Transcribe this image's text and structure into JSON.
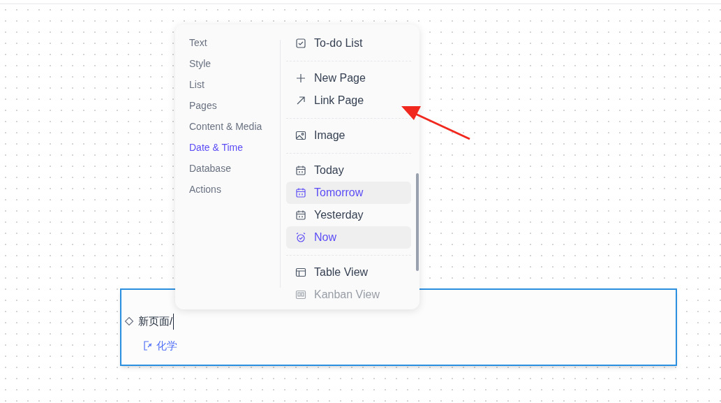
{
  "menu": {
    "categories": [
      {
        "label": "Text",
        "selected": false
      },
      {
        "label": "Style",
        "selected": false
      },
      {
        "label": "List",
        "selected": false
      },
      {
        "label": "Pages",
        "selected": false
      },
      {
        "label": "Content & Media",
        "selected": false
      },
      {
        "label": "Date & Time",
        "selected": true
      },
      {
        "label": "Database",
        "selected": false
      },
      {
        "label": "Actions",
        "selected": false
      }
    ],
    "groups": [
      [
        {
          "kind": "todo",
          "label": "To-do List",
          "selected": false,
          "disabled": false
        }
      ],
      [
        {
          "kind": "plus",
          "label": "New Page",
          "selected": false,
          "disabled": false
        },
        {
          "kind": "arrow",
          "label": "Link Page",
          "selected": false,
          "disabled": false
        }
      ],
      [
        {
          "kind": "image",
          "label": "Image",
          "selected": false,
          "disabled": false
        }
      ],
      [
        {
          "kind": "calendar",
          "label": "Today",
          "selected": false,
          "disabled": false
        },
        {
          "kind": "calendar",
          "label": "Tomorrow",
          "selected": true,
          "disabled": false
        },
        {
          "kind": "calendar",
          "label": "Yesterday",
          "selected": false,
          "disabled": false
        },
        {
          "kind": "alarm",
          "label": "Now",
          "selected": true,
          "disabled": false
        }
      ],
      [
        {
          "kind": "table",
          "label": "Table View",
          "selected": false,
          "disabled": false
        },
        {
          "kind": "kanban",
          "label": "Kanban View",
          "selected": false,
          "disabled": true
        }
      ]
    ]
  },
  "node": {
    "title": "新页面/",
    "link": "化学"
  }
}
